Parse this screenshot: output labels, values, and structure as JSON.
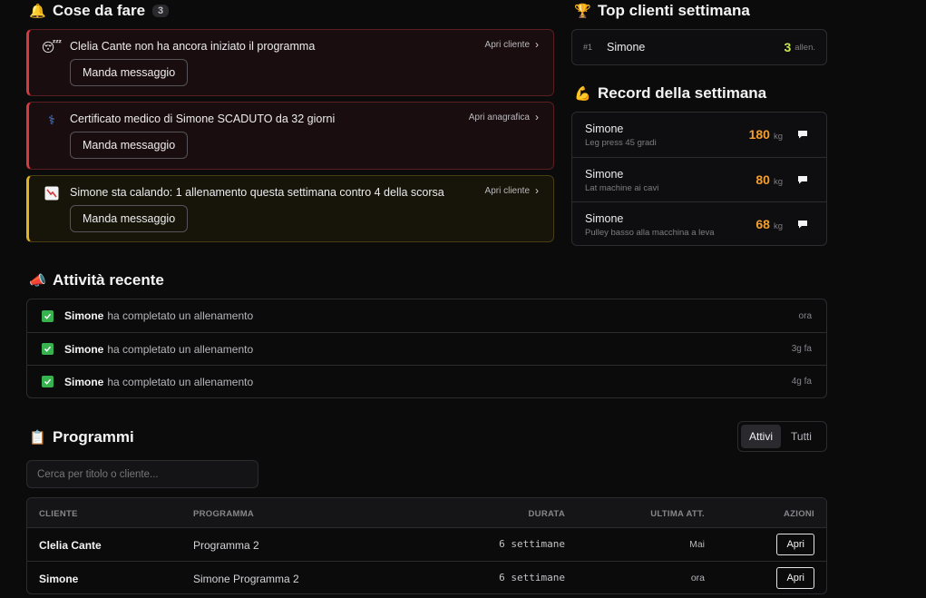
{
  "todo": {
    "title": "Cose da fare",
    "count": "3",
    "items": [
      {
        "text": "Clelia Cante non ha ancora iniziato il programma",
        "link": "Apri cliente",
        "button": "Manda messaggio",
        "icon": "sleep-face-icon"
      },
      {
        "text": "Certificato medico di Simone SCADUTO da 32 giorni",
        "link": "Apri anagrafica",
        "button": "Manda messaggio",
        "icon": "medical-icon"
      },
      {
        "text": "Simone sta calando: 1 allenamento questa settimana contro 4 della scorsa",
        "link": "Apri cliente",
        "button": "Manda messaggio",
        "icon": "chart-down-icon"
      }
    ]
  },
  "top_clients": {
    "title": "Top clienti settimana",
    "rows": [
      {
        "rank": "#1",
        "name": "Simone",
        "count": "3",
        "unit": "allen."
      }
    ]
  },
  "records": {
    "title": "Record della settimana",
    "rows": [
      {
        "name": "Simone",
        "exercise": "Leg press 45 gradi",
        "value": "180",
        "unit": "kg"
      },
      {
        "name": "Simone",
        "exercise": "Lat machine ai cavi",
        "value": "80",
        "unit": "kg"
      },
      {
        "name": "Simone",
        "exercise": "Pulley basso alla macchina a leva",
        "value": "68",
        "unit": "kg"
      }
    ]
  },
  "activity": {
    "title": "Attività recente",
    "rows": [
      {
        "who": "Simone",
        "what": "ha completato un allenamento",
        "when": "ora"
      },
      {
        "who": "Simone",
        "what": "ha completato un allenamento",
        "when": "3g fa"
      },
      {
        "who": "Simone",
        "what": "ha completato un allenamento",
        "when": "4g fa"
      }
    ]
  },
  "programs": {
    "title": "Programmi",
    "filter": {
      "active": "Attivi",
      "all": "Tutti"
    },
    "search_placeholder": "Cerca per titolo o cliente...",
    "columns": {
      "client": "CLIENTE",
      "program": "PROGRAMMA",
      "duration": "DURATA",
      "last": "ULTIMA ATT.",
      "actions": "AZIONI"
    },
    "rows": [
      {
        "client": "Clelia Cante",
        "program": "Programma 2",
        "duration": "6 settimane",
        "last": "Mai",
        "action": "Apri"
      },
      {
        "client": "Simone",
        "program": "Simone Programma 2",
        "duration": "6 settimane",
        "last": "ora",
        "action": "Apri"
      }
    ]
  },
  "colors": {
    "danger": "#d63a3f",
    "warning": "#e0b320",
    "top_count": "#c7e84a",
    "record_value": "#f59e2d",
    "success": "#36b24e"
  }
}
